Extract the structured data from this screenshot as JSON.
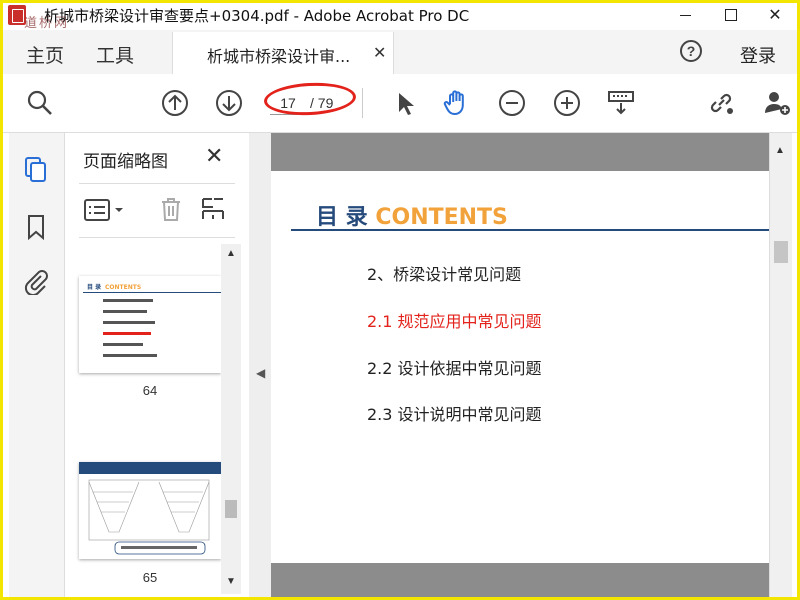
{
  "window": {
    "title": "析城市桥梁设计审查要点+0304.pdf - Adobe Acrobat Pro DC",
    "watermark": "道桥网"
  },
  "menubar": {
    "home": "主页",
    "tools": "工具",
    "doc_tab": "析城市桥梁设计审...",
    "login": "登录"
  },
  "toolbar": {
    "page_current": "17",
    "page_total": "/ 79"
  },
  "panel": {
    "title": "页面缩略图",
    "thumbnails": [
      {
        "page": "64"
      },
      {
        "page": "65"
      }
    ]
  },
  "document": {
    "toc_title_cn": "目 录",
    "toc_title_en": "CONTENTS",
    "items": [
      {
        "label": "2、桥梁设计常见问题",
        "active": false
      },
      {
        "label": "2.1 规范应用中常见问题",
        "active": true
      },
      {
        "label": "2.2  设计依据中常见问题",
        "active": false
      },
      {
        "label": "2.3  设计说明中常见问题",
        "active": false
      }
    ]
  },
  "colors": {
    "accent_red": "#e3231b",
    "toc_blue": "#254a7c",
    "toc_orange": "#f2a23a",
    "icon_blue": "#2a6fd6"
  }
}
